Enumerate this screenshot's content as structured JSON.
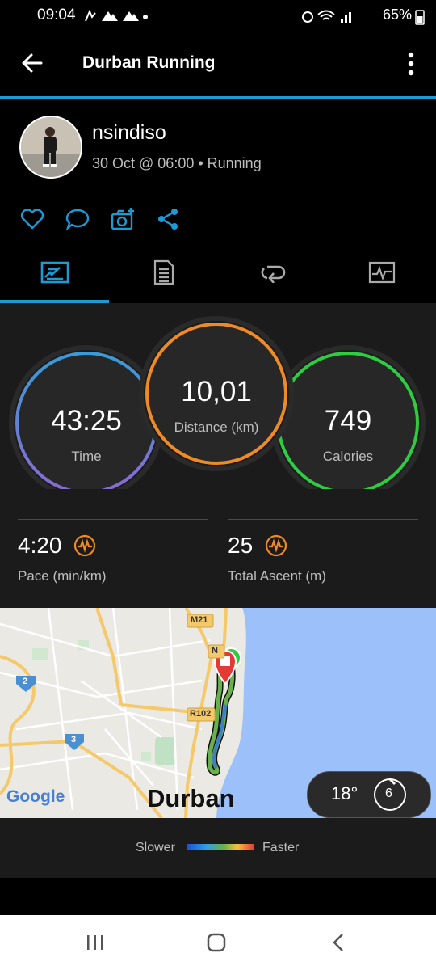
{
  "status_bar": {
    "time": "09:04",
    "battery": "65%"
  },
  "header": {
    "title": "Durban Running"
  },
  "profile": {
    "username": "nsindiso",
    "meta": "30 Oct @ 06:00 • Running"
  },
  "stats": {
    "time": {
      "value": "43:25",
      "label": "Time"
    },
    "distance": {
      "value": "10,01",
      "label": "Distance (km)"
    },
    "calories": {
      "value": "749",
      "label": "Calories"
    },
    "pace": {
      "value": "4:20",
      "label": "Pace (min/km)"
    },
    "ascent": {
      "value": "25",
      "label": "Total Ascent (m)"
    }
  },
  "map": {
    "city": "Durban",
    "google": "Google",
    "road_m21": "M21",
    "road_r102": "R102",
    "road_n": "N",
    "route_2": "2",
    "route_3": "3",
    "weather": {
      "temp": "18°",
      "wind": "6"
    }
  },
  "legend": {
    "slower": "Slower",
    "faster": "Faster"
  },
  "colors": {
    "accent": "#1c9ad6",
    "time_ring": "#3a9ad8",
    "distance_ring": "#f08a24",
    "calories_ring": "#2ecc40"
  }
}
